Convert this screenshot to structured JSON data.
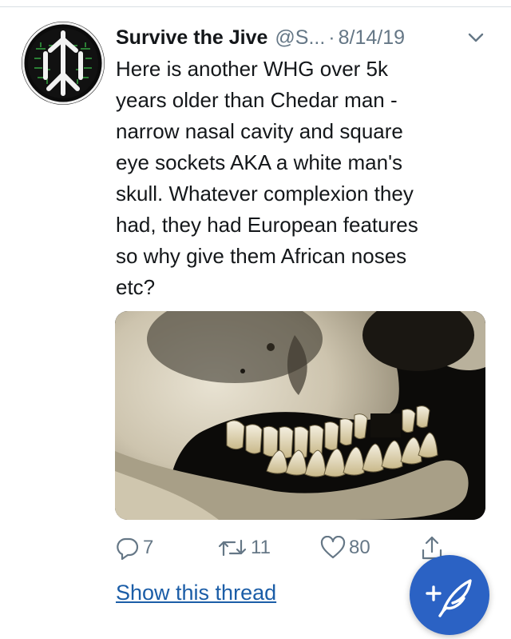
{
  "tweet": {
    "author_name": "Survive the Jive",
    "author_handle": "@S...",
    "separator": "·",
    "date": "8/14/19",
    "text": "Here is another WHG over 5k\nyears older than Chedar man -\nnarrow nasal cavity and square\neye sockets AKA a white man's\nskull. Whatever complexion they\nhad, they had European features\nso why give them African noses\netc?",
    "media_icon": "skull-photo"
  },
  "actions": {
    "reply_count": "7",
    "retweet_count": "11",
    "like_count": "80",
    "reply_icon": "reply-icon",
    "retweet_icon": "retweet-icon",
    "like_icon": "heart-icon",
    "share_icon": "share-icon"
  },
  "thread": {
    "show_thread_label": "Show this thread"
  },
  "compose": {
    "icon": "compose-feather-icon"
  },
  "colors": {
    "text_primary": "#14171a",
    "text_secondary": "#657786",
    "link": "#1b5da7",
    "fab": "#2b62c4",
    "avatar_green": "#3bbf4a"
  }
}
